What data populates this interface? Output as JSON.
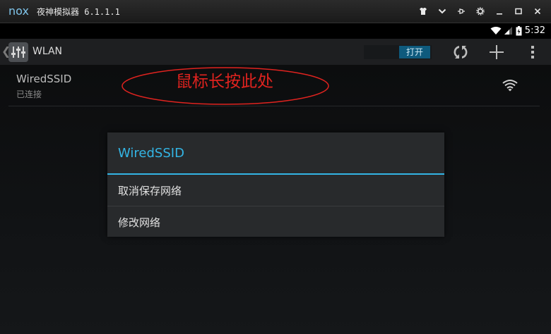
{
  "window": {
    "logo": "nox",
    "title": "夜神模拟器 6.1.1.1",
    "controls": [
      "shirt-icon",
      "chevron-down-icon",
      "pin-icon",
      "gear-icon",
      "minimize-icon",
      "maximize-icon",
      "close-icon"
    ]
  },
  "statusbar": {
    "time": "5:32"
  },
  "actionbar": {
    "title": "WLAN",
    "toggle_label": "打开"
  },
  "network": {
    "name": "WiredSSID",
    "status": "已连接"
  },
  "annotation": {
    "text": "鼠标长按此处",
    "color": "#e0231f"
  },
  "dialog": {
    "title": "WiredSSID",
    "items": [
      "取消保存网络",
      "修改网络"
    ],
    "accent": "#33b5e5"
  }
}
